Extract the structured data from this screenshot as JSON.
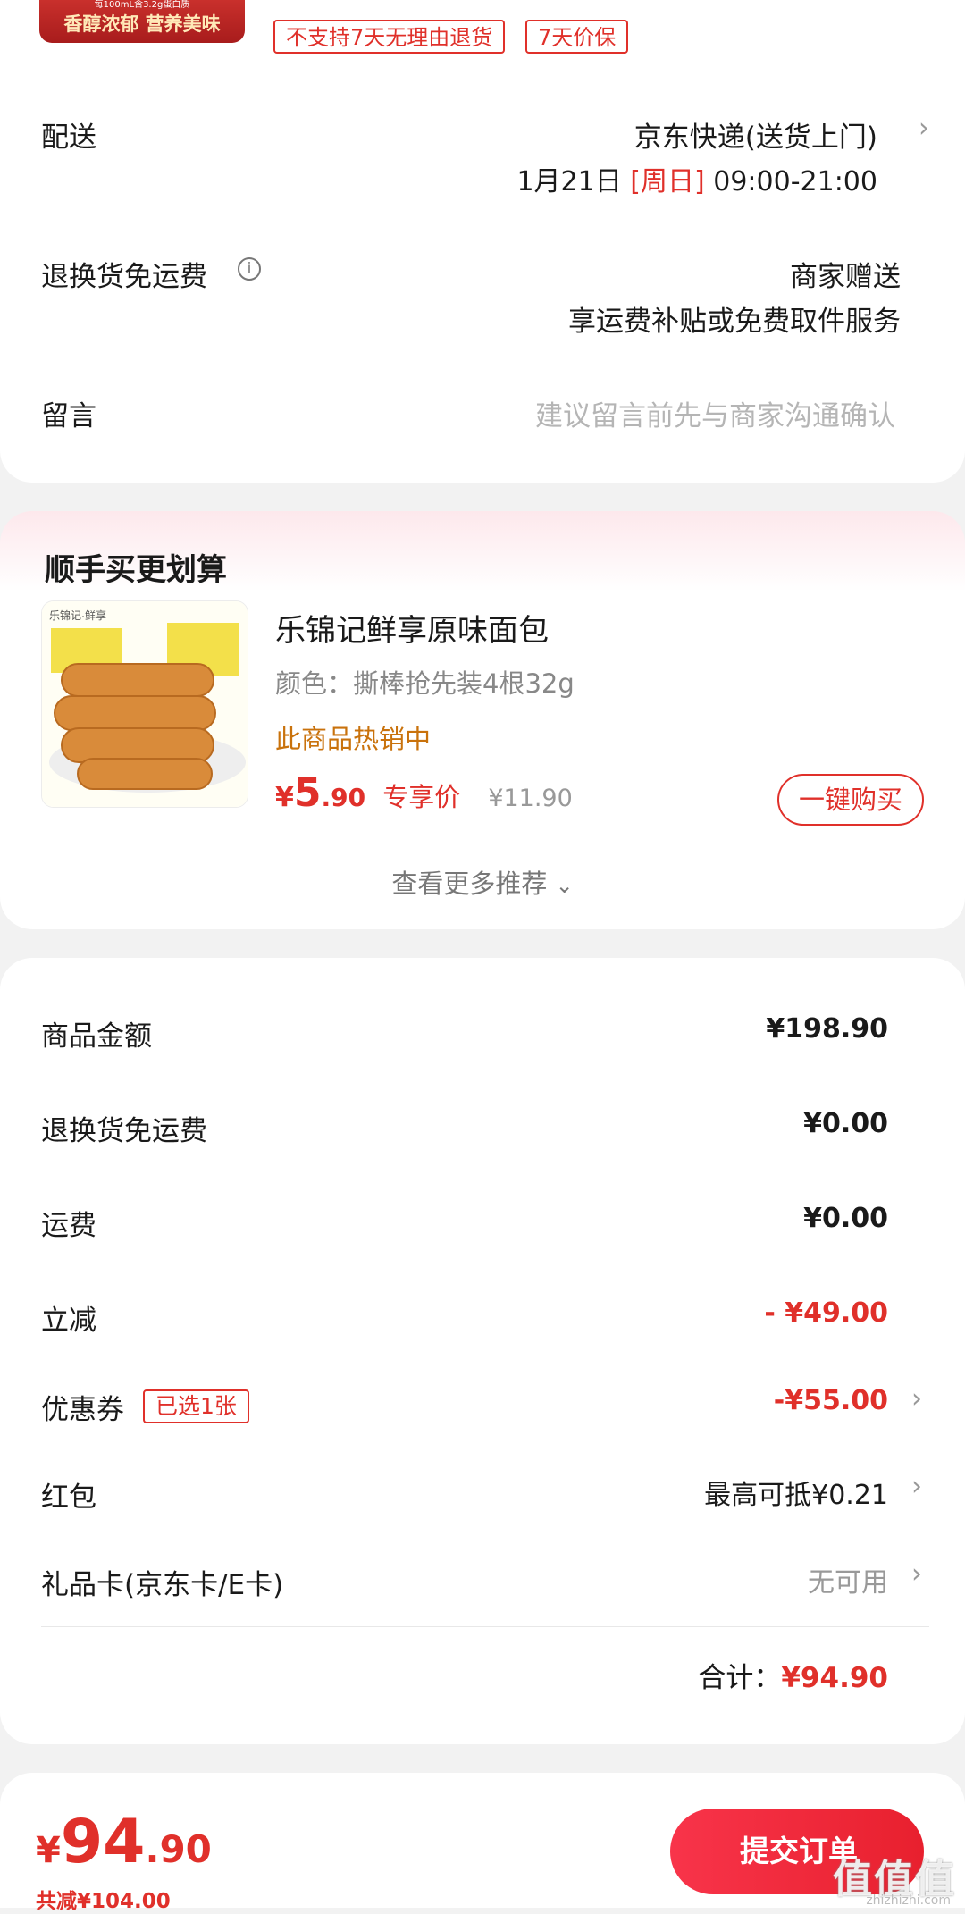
{
  "product_top": {
    "banner_small": "每100mL含3.2g蛋白质",
    "banner_text": "香醇浓郁 营养美味",
    "tag_no_return": "不支持7天无理由退货",
    "tag_price_protect": "7天价保"
  },
  "delivery": {
    "label": "配送",
    "method": "京东快递(送货上门)",
    "date": "1月21日",
    "weekday": "[周日]",
    "time": "09:00-21:00"
  },
  "return_shipping": {
    "label": "退换货免运费",
    "value": "商家赠送",
    "desc": "享运费补贴或免费取件服务"
  },
  "message": {
    "label": "留言",
    "placeholder": "建议留言前先与商家沟通确认"
  },
  "recommend": {
    "title": "顺手买更划算",
    "product_name": "乐锦记鲜享原味面包",
    "spec": "颜色：撕棒抢先装4根32g",
    "hot": "此商品热销中",
    "price_yen": "¥",
    "price_int": "5",
    "price_dec": ".90",
    "price_tag": "专享价",
    "price_old": "¥11.90",
    "buy_label": "一键购买",
    "more_label": "查看更多推荐",
    "img_brand": "乐锦记·鲜享"
  },
  "summary": {
    "goods_label": "商品金额",
    "goods_value": "¥198.90",
    "return_label": "退换货免运费",
    "return_value": "¥0.00",
    "freight_label": "运费",
    "freight_value": "¥0.00",
    "discount_label": "立减",
    "discount_value": "- ¥49.00",
    "coupon_label": "优惠券",
    "coupon_badge": "已选1张",
    "coupon_value": "-¥55.00",
    "redpacket_label": "红包",
    "redpacket_value": "最高可抵¥0.21",
    "giftcard_label": "礼品卡(京东卡/E卡)",
    "giftcard_value": "无可用",
    "total_label": "合计：",
    "total_value": "¥94.90"
  },
  "bottom_bar": {
    "yen": "¥",
    "price_int": "94",
    "price_dec": ".90",
    "saved": "共减¥104.00",
    "submit_label": "提交订单"
  },
  "watermark": {
    "main": "值值值",
    "sub": "zhizhizhi.com"
  },
  "colors": {
    "accent": "#e0302a",
    "hot": "#c9720c",
    "bg": "#f2f2f2"
  }
}
